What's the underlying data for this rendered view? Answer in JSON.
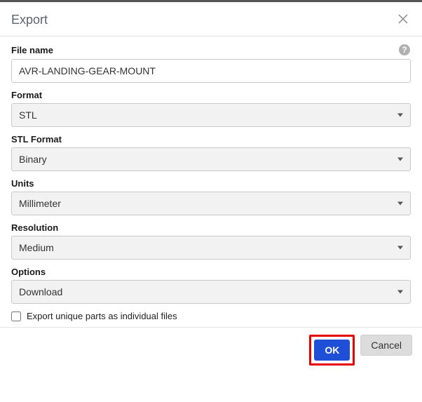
{
  "dialog": {
    "title": "Export"
  },
  "fields": {
    "filename_label": "File name",
    "filename_value": "AVR-LANDING-GEAR-MOUNT",
    "format_label": "Format",
    "format_value": "STL",
    "stlformat_label": "STL Format",
    "stlformat_value": "Binary",
    "units_label": "Units",
    "units_value": "Millimeter",
    "resolution_label": "Resolution",
    "resolution_value": "Medium",
    "options_label": "Options",
    "options_value": "Download",
    "checkbox_label": "Export unique parts as individual files",
    "checkbox_checked": false
  },
  "buttons": {
    "ok": "OK",
    "cancel": "Cancel"
  }
}
